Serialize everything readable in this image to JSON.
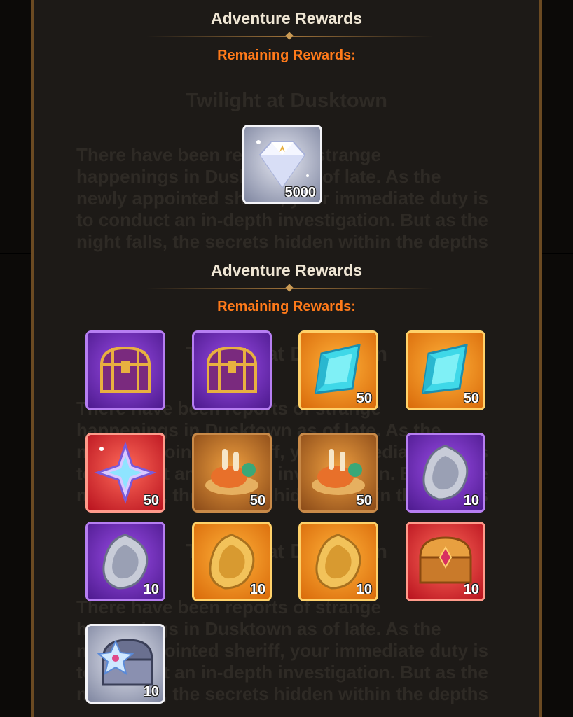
{
  "top_panel": {
    "title": "Adventure Rewards",
    "subtitle": "Remaining Rewards:",
    "bg_heading": "Twilight at Dusktown",
    "bg_text": "There have been reports of strange\nhappenings in Dusktown as of late. As the\nnewly appointed sheriff, your immediate duty is\nto conduct an in-depth investigation. But as the\nnight falls, the secrets hidden within the depths",
    "rewards": [
      {
        "icon": "diamond-icon",
        "qty": "5000",
        "rarity": "silver"
      }
    ]
  },
  "bottom_panel": {
    "title": "Adventure Rewards",
    "subtitle": "Remaining Rewards:",
    "bg_heading": "Twilight at Dusktown",
    "bg_text": "There have been reports of strange\nhappenings in Dusktown as of late. As the\nnewly appointed sheriff, your immediate duty is\nto conduct an in-depth investigation. But as the\nnight falls, the secrets hidden within the depths",
    "rewards": [
      {
        "icon": "purple-treasure-chest-icon",
        "qty": "",
        "rarity": "purple"
      },
      {
        "icon": "purple-treasure-chest-icon",
        "qty": "",
        "rarity": "purple"
      },
      {
        "icon": "cyan-crystal-icon",
        "qty": "50",
        "rarity": "orange"
      },
      {
        "icon": "cyan-crystal-icon",
        "qty": "50",
        "rarity": "orange"
      },
      {
        "icon": "prism-star-shard-icon",
        "qty": "50",
        "rarity": "red"
      },
      {
        "icon": "food-platter-icon",
        "qty": "50",
        "rarity": "brown"
      },
      {
        "icon": "food-platter-icon",
        "qty": "50",
        "rarity": "brown"
      },
      {
        "icon": "silver-coin-icon",
        "qty": "10",
        "rarity": "purple"
      },
      {
        "icon": "silver-coin-icon",
        "qty": "10",
        "rarity": "purple"
      },
      {
        "icon": "gold-coin-icon",
        "qty": "10",
        "rarity": "orange"
      },
      {
        "icon": "gold-coin-icon",
        "qty": "10",
        "rarity": "orange"
      },
      {
        "icon": "golden-jeweled-chest-icon",
        "qty": "10",
        "rarity": "red"
      },
      {
        "icon": "silver-star-chest-icon",
        "qty": "10",
        "rarity": "silver"
      }
    ]
  },
  "colors": {
    "title": "#efe6d4",
    "subtitle": "#ff7a1a",
    "panel_bg": "#1d1a17",
    "border": "#6b4a22"
  }
}
